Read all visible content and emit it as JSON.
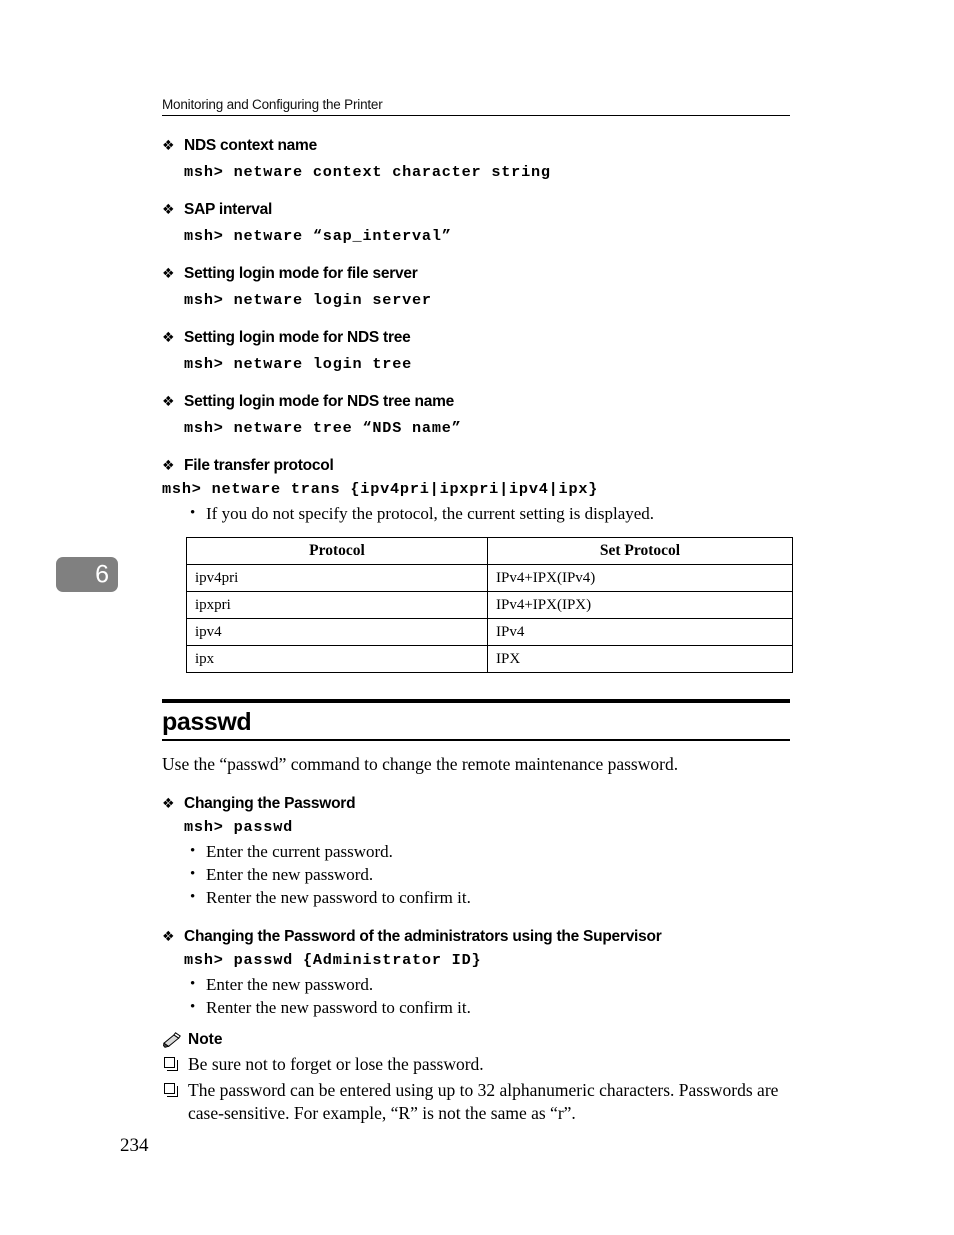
{
  "page": {
    "running_header": "Monitoring and Configuring the Printer",
    "chapter_tab": "6",
    "folio": "234"
  },
  "netware_entries": [
    {
      "heading": "NDS context name",
      "command": "msh> netware context character string",
      "indent": true
    },
    {
      "heading": "SAP interval",
      "command": "msh> netware “sap_interval”",
      "indent": true
    },
    {
      "heading": "Setting login mode for file server",
      "command": "msh> netware login server",
      "indent": true
    },
    {
      "heading": "Setting login mode for NDS tree",
      "command": "msh> netware login tree",
      "indent": true
    },
    {
      "heading": "Setting login mode for NDS tree name",
      "command": "msh> netware tree “NDS name”",
      "indent": true
    },
    {
      "heading": "File transfer protocol",
      "command": "msh> netware trans {ipv4pri|ipxpri|ipv4|ipx}",
      "indent": false
    }
  ],
  "transfer_note": "If you do not specify the protocol, the current setting is displayed.",
  "protocol_table": {
    "headers": [
      "Protocol",
      "Set Protocol"
    ],
    "rows": [
      [
        "ipv4pri",
        "IPv4+IPX(IPv4)"
      ],
      [
        "ipxpri",
        "IPv4+IPX(IPX)"
      ],
      [
        "ipv4",
        "IPv4"
      ],
      [
        "ipx",
        "IPX"
      ]
    ]
  },
  "passwd_section": {
    "title": "passwd",
    "intro": "Use the “passwd” command to change the remote maintenance password.",
    "blocks": [
      {
        "heading": "Changing the Password",
        "command": "msh> passwd",
        "bullets": [
          "Enter the current password.",
          "Enter the new password.",
          "Renter the new password to confirm it."
        ]
      },
      {
        "heading": "Changing the Password of the administrators using the Supervisor",
        "command": "msh> passwd {Administrator ID}",
        "bullets": [
          "Enter the new password.",
          "Renter the new password to confirm it."
        ]
      }
    ]
  },
  "note": {
    "label": "Note",
    "items": [
      "Be sure not to forget or lose the password.",
      "The password can be entered using up to 32 alphanumeric characters. Passwords are case-sensitive. For example, “R” is not the same as “r”."
    ]
  },
  "glyphs": {
    "diamond_bullet": "❖",
    "round_bullet": "•"
  },
  "colors": {
    "text": "#000000",
    "page_background": "#ffffff",
    "chapter_tab_background": "#808080",
    "chapter_tab_text": "#ffffff"
  }
}
